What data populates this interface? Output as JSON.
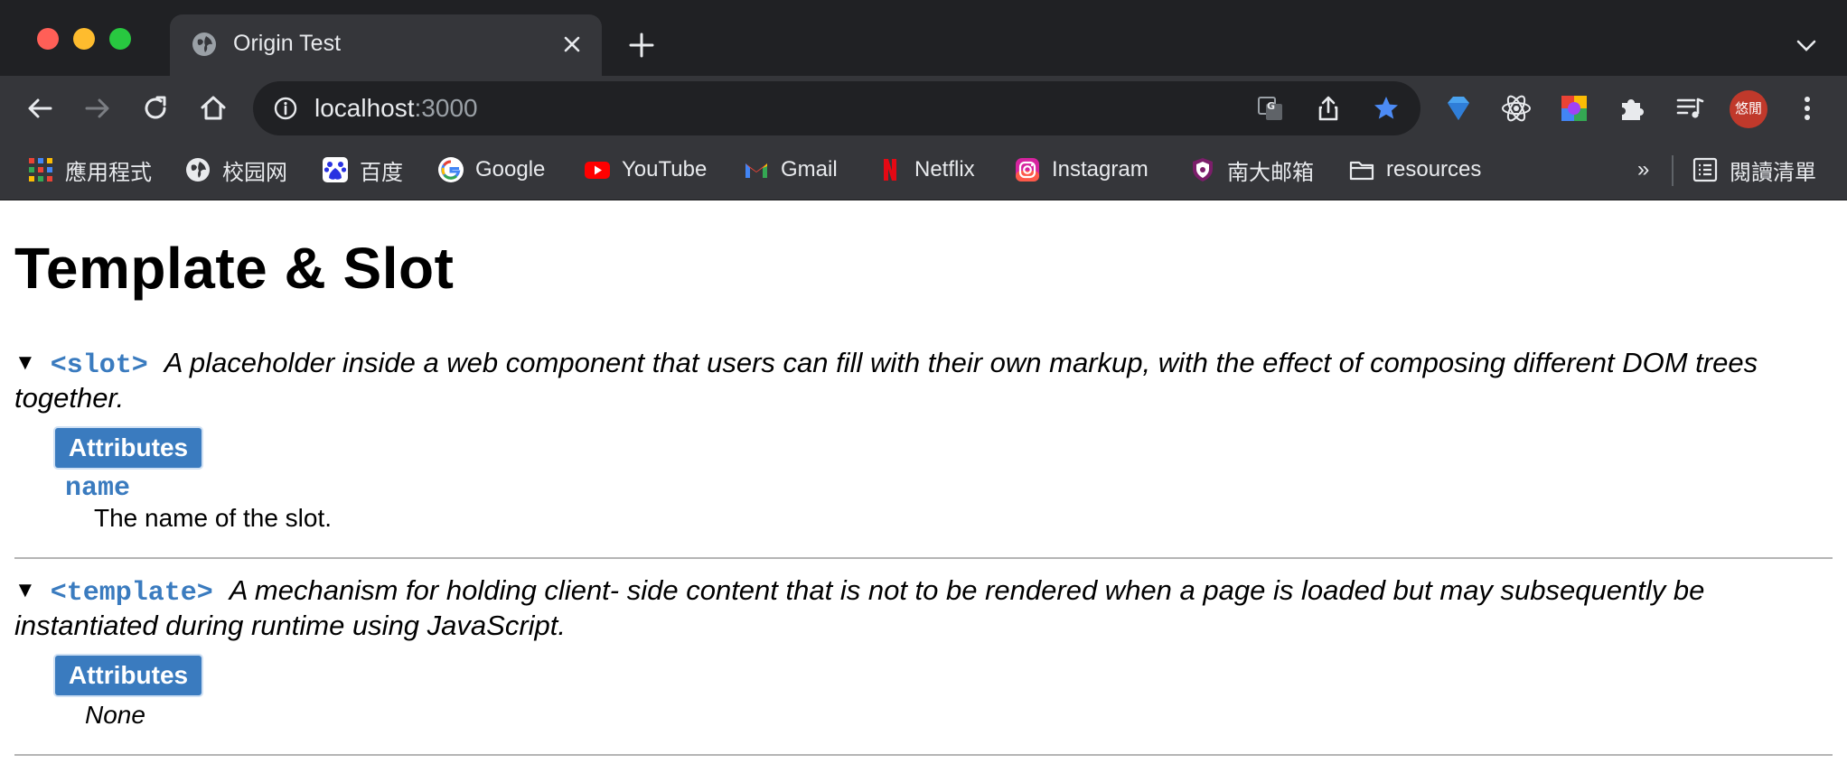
{
  "browser": {
    "tab_title": "Origin Test",
    "url_host": "localhost",
    "url_port": ":3000",
    "avatar_text": "悠閒",
    "colors": {
      "frame": "#202124",
      "toolbar": "#35363a",
      "star": "#4c8bf5",
      "avatar": "#c0392b"
    },
    "bookmarks": [
      {
        "label": "應用程式",
        "icon": "apps-grid-icon"
      },
      {
        "label": "校园网",
        "icon": "globe-icon"
      },
      {
        "label": "百度",
        "icon": "baidu-icon"
      },
      {
        "label": "Google",
        "icon": "google-icon"
      },
      {
        "label": "YouTube",
        "icon": "youtube-icon"
      },
      {
        "label": "Gmail",
        "icon": "gmail-icon"
      },
      {
        "label": "Netflix",
        "icon": "netflix-icon"
      },
      {
        "label": "Instagram",
        "icon": "instagram-icon"
      },
      {
        "label": "南大邮箱",
        "icon": "shield-icon"
      },
      {
        "label": "resources",
        "icon": "folder-icon"
      }
    ],
    "overflow_label": "»",
    "reading_list_label": "閱讀清單"
  },
  "page": {
    "title": "Template & Slot",
    "entries": [
      {
        "toggle": "▼",
        "tag": "<slot>",
        "description": "A placeholder inside a web component that users can fill with their own markup, with the effect of composing different DOM trees together.",
        "attributes_label": "Attributes",
        "attributes": [
          {
            "name": "name",
            "description": "The name of the slot."
          }
        ]
      },
      {
        "toggle": "▼",
        "tag": "<template>",
        "description": "A mechanism for holding client- side content that is not to be rendered when a page is loaded but may subsequently be instantiated during runtime using JavaScript.",
        "attributes_label": "Attributes",
        "none_label": "None"
      }
    ],
    "colors": {
      "accent": "#3a7bbf",
      "rule": "#b5b5b5"
    }
  }
}
